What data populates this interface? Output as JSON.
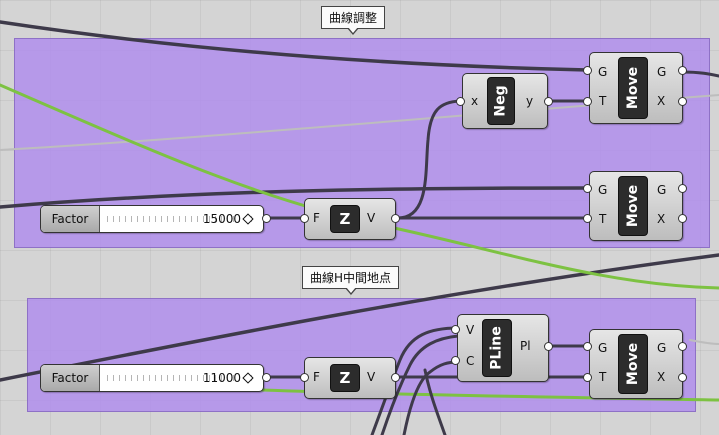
{
  "groups": {
    "top_title": "曲線調整",
    "bottom_title": "曲線H中間地点"
  },
  "sliders": [
    {
      "label": "Factor",
      "value": "15000"
    },
    {
      "label": "Factor",
      "value": "11000"
    }
  ],
  "components": {
    "unit_z_1": {
      "in": "F",
      "core": "Z",
      "out": "V"
    },
    "unit_z_2": {
      "in": "F",
      "core": "Z",
      "out": "V"
    },
    "negative": {
      "in": "x",
      "core": "Neg",
      "out": "y"
    },
    "move_1": {
      "in_geometry": "G",
      "in_motion": "T",
      "core": "Move",
      "out_geometry": "G",
      "out_transform": "X"
    },
    "move_2": {
      "in_geometry": "G",
      "in_motion": "T",
      "core": "Move",
      "out_geometry": "G",
      "out_transform": "X"
    },
    "move_3": {
      "in_geometry": "G",
      "in_motion": "T",
      "core": "Move",
      "out_geometry": "G",
      "out_transform": "X"
    },
    "polyline": {
      "in_vertices": "V",
      "in_closed": "C",
      "core": "PLine",
      "out": "Pl"
    }
  },
  "colors": {
    "group_fill": "#b08cee",
    "wire_dark": "#3e3a4a",
    "wire_green": "#7dc242",
    "wire_light": "#b9b9b9"
  }
}
